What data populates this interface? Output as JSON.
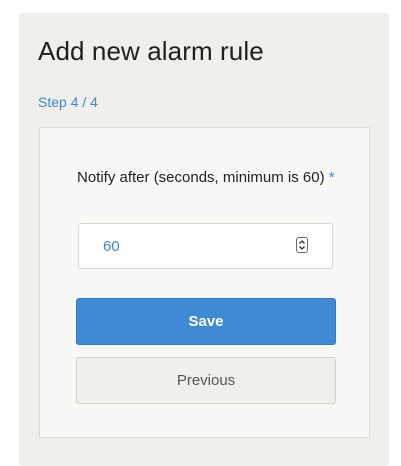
{
  "form": {
    "title": "Add new alarm rule",
    "step_label": "Step 4 / 4",
    "field": {
      "label": "Notify after (seconds, minimum is 60)",
      "required_marker": "*",
      "value": "60"
    },
    "save_label": "Save",
    "previous_label": "Previous"
  },
  "icons": {
    "spinner": "up-down-spinner-icon"
  },
  "colors": {
    "accent": "#3f86d0",
    "primary_button": "#4289d3",
    "panel_background": "#efefeb",
    "card_background": "#f8f8f7"
  }
}
